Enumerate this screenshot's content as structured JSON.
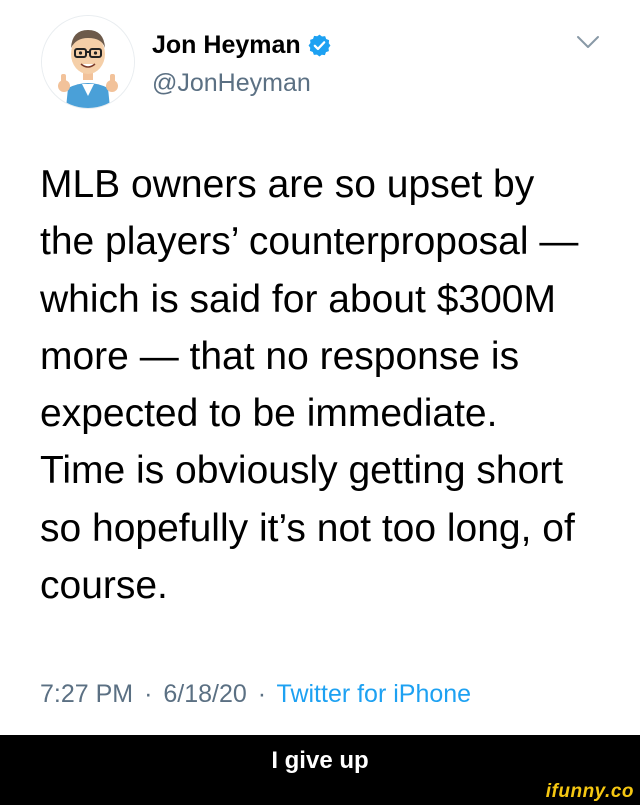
{
  "tweet": {
    "author": {
      "display_name": "Jon Heyman",
      "handle": "@JonHeyman",
      "verified": true,
      "avatar_icon": "cartoon-avatar-icon",
      "verified_icon": "verified-badge-icon"
    },
    "menu_icon": "chevron-down-icon",
    "text_lines": [
      "MLB owners are so upset by",
      "the players’ counterproposal —",
      "which is said for about $300M",
      "more — that no response is",
      "expected to be immediate.",
      "Time is obviously getting short",
      "so hopefully it’s not too long, of",
      "course."
    ],
    "time": "7:27 PM",
    "date": "6/18/20",
    "separator": "·",
    "source": "Twitter for iPhone"
  },
  "caption": {
    "text": "I give up"
  },
  "watermark": {
    "text": "ifunny.co"
  },
  "colors": {
    "background": "#ffffff",
    "text": "#000000",
    "secondary_text": "#5b7083",
    "link": "#1da1f2",
    "verified": "#1da1f2",
    "caption_bar": "#000000",
    "watermark": "#f5c712"
  }
}
